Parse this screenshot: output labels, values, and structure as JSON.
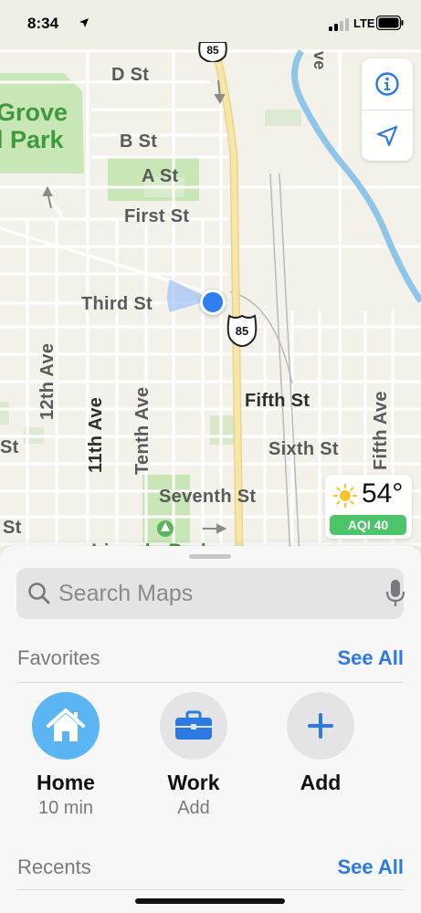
{
  "status_bar": {
    "time": "8:34",
    "network": "LTE",
    "icons": [
      "location-arrow-icon",
      "signal-bars-icon",
      "battery-icon"
    ]
  },
  "map": {
    "park_top_left": [
      "Grove",
      "l Park"
    ],
    "park_bottom": "Lincoln Park",
    "streets": {
      "d_st": "D St",
      "b_st": "B St",
      "a_st": "A St",
      "first_st": "First St",
      "third_st": "Third St",
      "fifth_st": "Fifth St",
      "sixth_st": "Sixth St",
      "seventh_st": "Seventh St",
      "left_st_1": "St",
      "left_st_2": "St",
      "twelfth_ave": "12th Ave",
      "eleventh_ave": "11th Ave",
      "tenth_ave": "Tenth Ave",
      "fifth_ave": "Fifth Ave",
      "top_right_ave": "ve"
    },
    "highway_number": "85",
    "weather": {
      "temperature": "54°",
      "aqi": "AQI 40",
      "icon": "sun-icon"
    },
    "controls": {
      "info_icon": "info-icon",
      "locate_icon": "location-arrow-icon"
    },
    "colors": {
      "land": "#f4f1ea",
      "park": "#c9e6b7",
      "highway": "#f6e7a8",
      "water": "#8fc6e8",
      "user_dot": "#2d7ff0"
    }
  },
  "sheet": {
    "search": {
      "placeholder": "Search Maps",
      "value": ""
    },
    "favorites": {
      "title": "Favorites",
      "see_all": "See All",
      "items": [
        {
          "label": "Home",
          "sub": "10 min",
          "icon": "house-icon",
          "color": "#5ab5f2"
        },
        {
          "label": "Work",
          "sub": "Add",
          "icon": "briefcase-icon",
          "color": "#e4e4e6"
        },
        {
          "label": "Add",
          "sub": "",
          "icon": "plus-icon",
          "color": "#e4e4e6"
        }
      ]
    },
    "recents": {
      "title": "Recents",
      "see_all": "See All"
    }
  }
}
